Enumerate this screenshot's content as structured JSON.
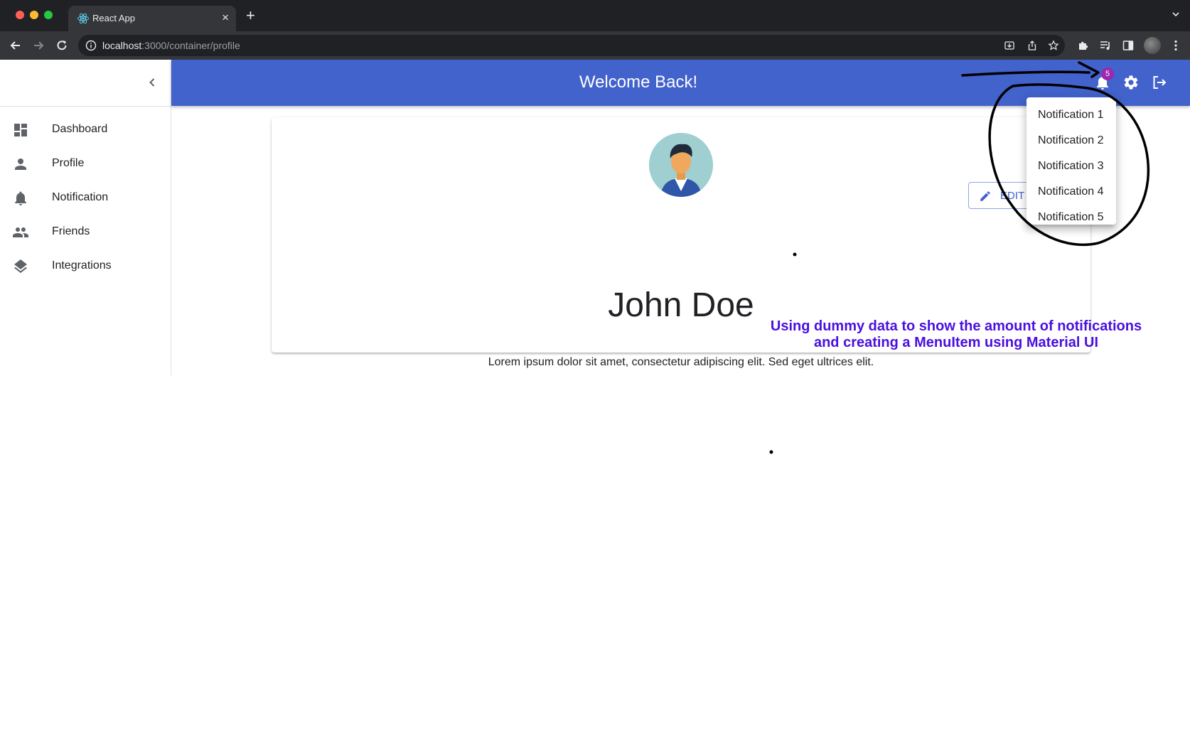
{
  "browser": {
    "tab_title": "React App",
    "url_host": "localhost",
    "url_rest": ":3000/container/profile"
  },
  "sidebar": {
    "items": [
      {
        "label": "Dashboard",
        "icon": "dashboard-icon"
      },
      {
        "label": "Profile",
        "icon": "person-icon"
      },
      {
        "label": "Notification",
        "icon": "bell-icon"
      },
      {
        "label": "Friends",
        "icon": "people-icon"
      },
      {
        "label": "Integrations",
        "icon": "layers-icon"
      }
    ]
  },
  "appbar": {
    "title": "Welcome Back!",
    "notification_count": "5",
    "color": "#4262cc",
    "badge_color": "#9c27b0"
  },
  "profile": {
    "edit_label": "EDIT",
    "name": "John Doe",
    "bio": "Lorem ipsum dolor sit amet, consectetur adipiscing elit. Sed eget ultrices elit."
  },
  "notification_menu": {
    "items": [
      "Notification 1",
      "Notification 2",
      "Notification 3",
      "Notification 4",
      "Notification 5"
    ]
  },
  "annotation": {
    "line1": "Using dummy data to show the amount of notifications",
    "line2": "and creating a MenuItem using Material UI",
    "color": "#4a10e0"
  }
}
